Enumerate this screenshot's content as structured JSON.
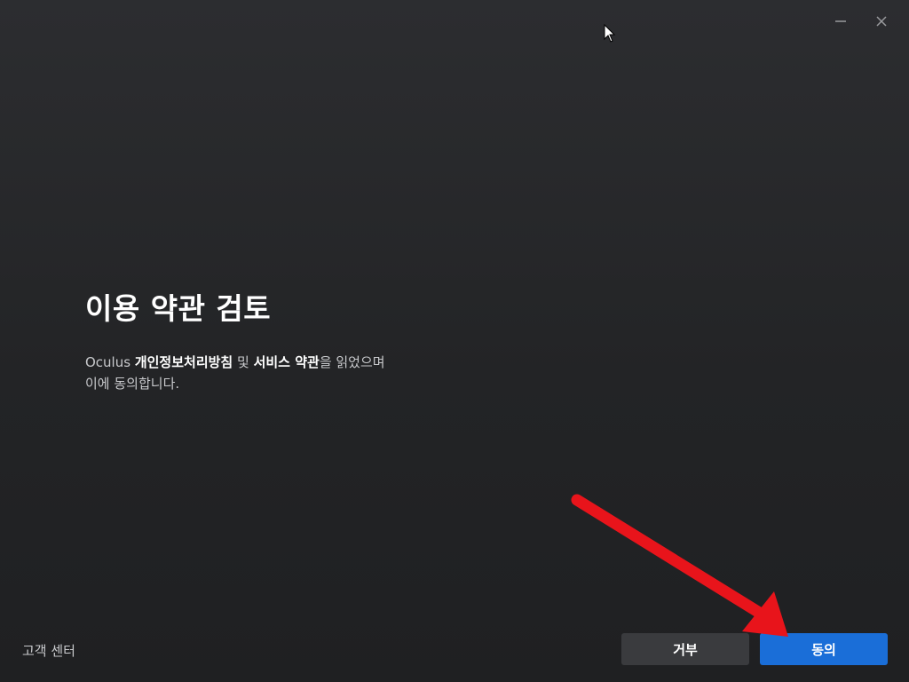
{
  "window": {
    "minimize_icon": "minimize-icon",
    "close_icon": "close-icon"
  },
  "main": {
    "title": "이용 약관 검토",
    "desc_prefix": "Oculus ",
    "privacy_link": "개인정보처리방침",
    "desc_and": " 및 ",
    "terms_link": "서비스 약관",
    "desc_suffix_line1": "을 읽었으며",
    "desc_line2": "이에 동의합니다."
  },
  "footer": {
    "support_link": "고객 센터",
    "decline_label": "거부",
    "accept_label": "동의"
  },
  "colors": {
    "accent": "#1a6ed8",
    "decline_bg": "#3a3b3e",
    "annotation_arrow": "#e8141b"
  }
}
